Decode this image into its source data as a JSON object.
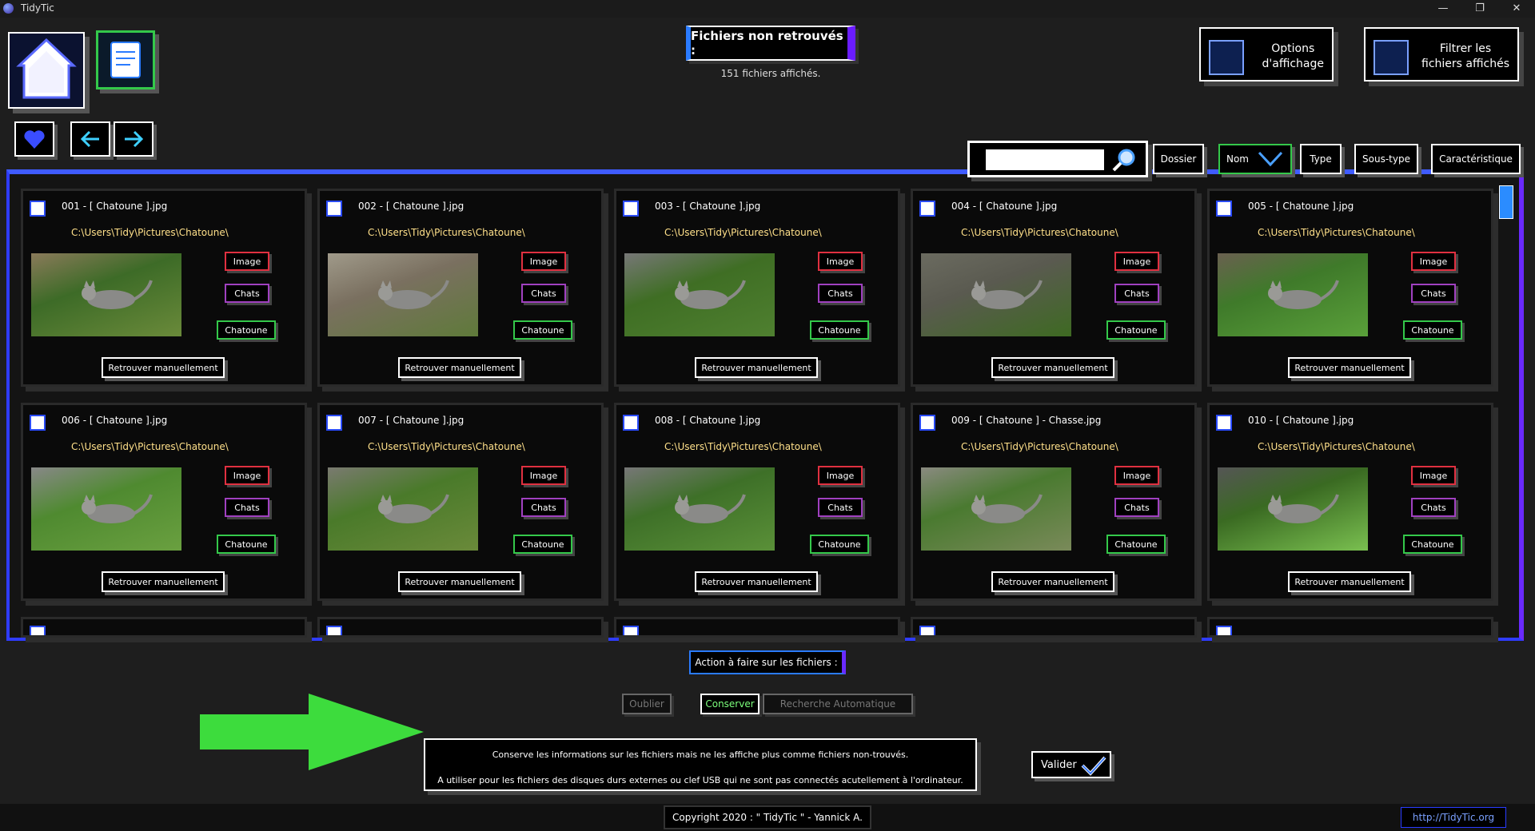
{
  "window": {
    "title": "TidyTic"
  },
  "header": {
    "title": "Fichiers non retrouvés :",
    "subtitle": "151 fichiers affichés."
  },
  "topButtons": {
    "options": {
      "line1": "Options",
      "line2": "d'affichage"
    },
    "filter": {
      "line1": "Filtrer les",
      "line2": "fichiers affichés"
    }
  },
  "sortBar": {
    "search_value": "",
    "dossier": "Dossier",
    "nom": "Nom",
    "type": "Type",
    "soustype": "Sous-type",
    "caracteristique": "Caractéristique"
  },
  "files": [
    {
      "name": "001 - [ Chatoune ].jpg",
      "path": "C:\\Users\\Tidy\\Pictures\\Chatoune\\",
      "tags": [
        "Image",
        "Chats",
        "Chatoune"
      ],
      "action": "Retrouver manuellement"
    },
    {
      "name": "002 - [ Chatoune ].jpg",
      "path": "C:\\Users\\Tidy\\Pictures\\Chatoune\\",
      "tags": [
        "Image",
        "Chats",
        "Chatoune"
      ],
      "action": "Retrouver manuellement"
    },
    {
      "name": "003 - [ Chatoune ].jpg",
      "path": "C:\\Users\\Tidy\\Pictures\\Chatoune\\",
      "tags": [
        "Image",
        "Chats",
        "Chatoune"
      ],
      "action": "Retrouver manuellement"
    },
    {
      "name": "004 - [ Chatoune ].jpg",
      "path": "C:\\Users\\Tidy\\Pictures\\Chatoune\\",
      "tags": [
        "Image",
        "Chats",
        "Chatoune"
      ],
      "action": "Retrouver manuellement"
    },
    {
      "name": "005 - [ Chatoune ].jpg",
      "path": "C:\\Users\\Tidy\\Pictures\\Chatoune\\",
      "tags": [
        "Image",
        "Chats",
        "Chatoune"
      ],
      "action": "Retrouver manuellement"
    },
    {
      "name": "006 - [ Chatoune ].jpg",
      "path": "C:\\Users\\Tidy\\Pictures\\Chatoune\\",
      "tags": [
        "Image",
        "Chats",
        "Chatoune"
      ],
      "action": "Retrouver manuellement"
    },
    {
      "name": "007 - [ Chatoune ].jpg",
      "path": "C:\\Users\\Tidy\\Pictures\\Chatoune\\",
      "tags": [
        "Image",
        "Chats",
        "Chatoune"
      ],
      "action": "Retrouver manuellement"
    },
    {
      "name": "008 - [ Chatoune ].jpg",
      "path": "C:\\Users\\Tidy\\Pictures\\Chatoune\\",
      "tags": [
        "Image",
        "Chats",
        "Chatoune"
      ],
      "action": "Retrouver manuellement"
    },
    {
      "name": "009 - [ Chatoune ] - Chasse.jpg",
      "path": "C:\\Users\\Tidy\\Pictures\\Chatoune\\",
      "tags": [
        "Image",
        "Chats",
        "Chatoune"
      ],
      "action": "Retrouver manuellement"
    },
    {
      "name": "010 - [ Chatoune ].jpg",
      "path": "C:\\Users\\Tidy\\Pictures\\Chatoune\\",
      "tags": [
        "Image",
        "Chats",
        "Chatoune"
      ],
      "action": "Retrouver manuellement"
    }
  ],
  "actions": {
    "title": "Action à faire sur les fichiers :",
    "oublier": "Oublier",
    "conserver": "Conserver",
    "recherche": "Recherche Automatique",
    "selected": "Conserver",
    "desc_line1": "Conserve les informations sur les fichiers mais ne les affiche plus comme fichiers non-trouvés.",
    "desc_line2": "A utiliser pour les fichiers des disques durs externes ou clef USB qui ne sont pas connectés acutellement à l'ordinateur.",
    "valider": "Valider"
  },
  "footer": {
    "copyright": "Copyright 2020 : \" TidyTic \" - Yannick A.",
    "link": "http://TidyTic.org"
  },
  "colors": {
    "accent_blue": "#2f3cff",
    "accent_purple": "#6a2aff",
    "tag_image": "#e03040",
    "tag_chats": "#a040c0",
    "tag_chatoune": "#34c84a",
    "arrow": "#3ddc3d"
  }
}
